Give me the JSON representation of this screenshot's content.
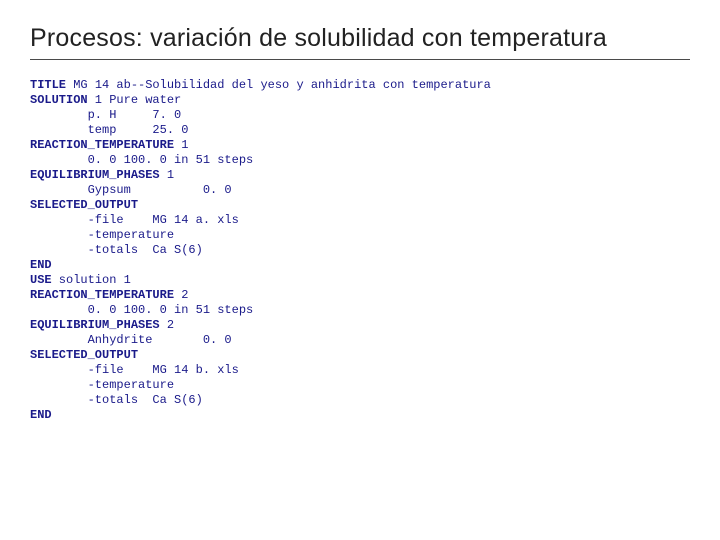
{
  "title": "Procesos: variación de solubilidad con temperatura",
  "code": {
    "k_title": "TITLE",
    "title_text": " MG 14 ab--Solubilidad del yeso y anhidrita con temperatura",
    "k_solution": "SOLUTION",
    "solution_text": " 1 Pure water",
    "ph_line": "        p. H     7. 0",
    "temp_line": "        temp     25. 0",
    "k_rt1": "REACTION_TEMPERATURE",
    "rt1_text": " 1",
    "rt1_range": "        0. 0 100. 0 in 51 steps",
    "k_ep1": "EQUILIBRIUM_PHASES",
    "ep1_text": " 1",
    "ep1_phase": "        Gypsum          0. 0",
    "k_so1": "SELECTED_OUTPUT",
    "so1_file": "        -file    MG 14 a. xls",
    "so1_temp": "        -temperature",
    "so1_totals": "        -totals  Ca S(6)",
    "k_end1": "END",
    "k_use": "USE",
    "use_text": " solution 1",
    "k_rt2": "REACTION_TEMPERATURE",
    "rt2_text": " 2",
    "rt2_range": "        0. 0 100. 0 in 51 steps",
    "k_ep2": "EQUILIBRIUM_PHASES",
    "ep2_text": " 2",
    "ep2_phase": "        Anhydrite       0. 0",
    "k_so2": "SELECTED_OUTPUT",
    "so2_file": "        -file    MG 14 b. xls",
    "so2_temp": "        -temperature",
    "so2_totals": "        -totals  Ca S(6)",
    "k_end2": "END"
  }
}
